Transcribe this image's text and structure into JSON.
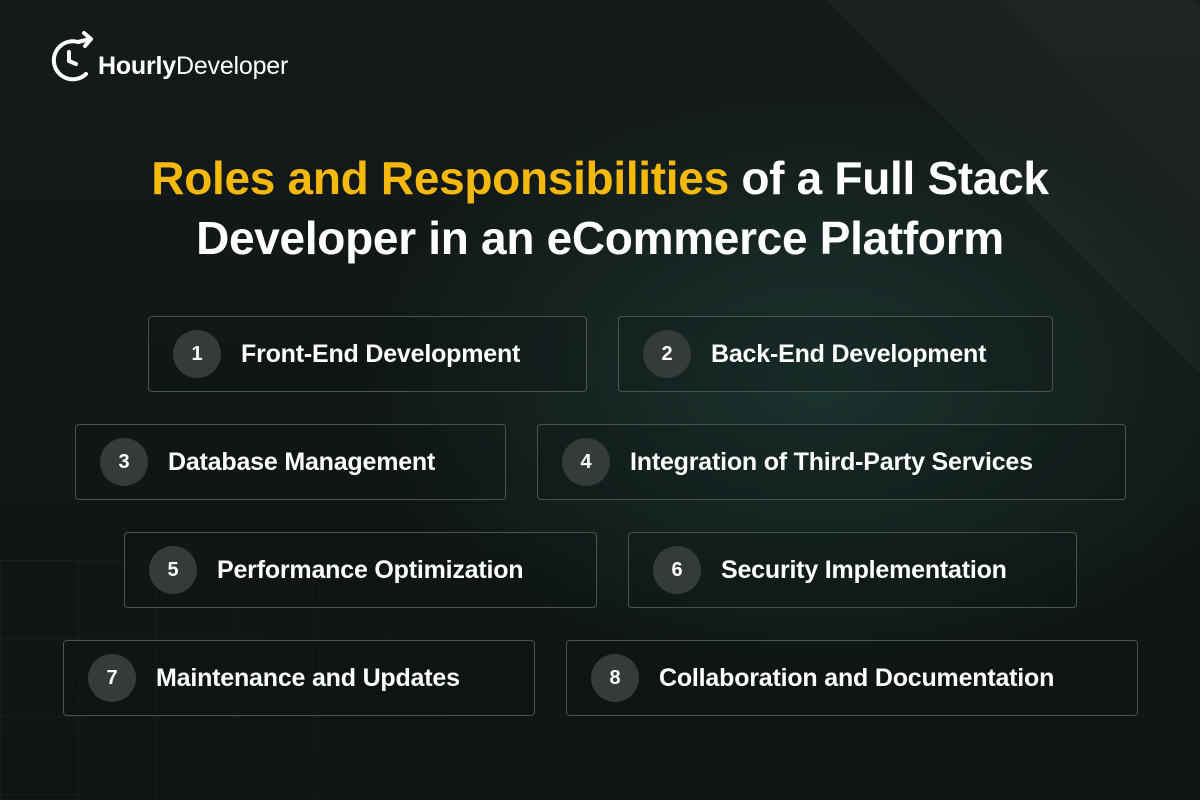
{
  "logo": {
    "brand_bold": "Hourly",
    "brand_regular": "Developer"
  },
  "heading": {
    "highlight": "Roles and Responsibilities",
    "rest_line1": " of a Full Stack",
    "line2": "Developer in an eCommerce Platform"
  },
  "colors": {
    "accent": "#f5b90b",
    "background": "#131919",
    "pill_border": "#4a5352",
    "number_circle": "#353b3b"
  },
  "items": [
    {
      "number": "1",
      "label": "Front-End Development"
    },
    {
      "number": "2",
      "label": "Back-End Development"
    },
    {
      "number": "3",
      "label": "Database Management"
    },
    {
      "number": "4",
      "label": "Integration of Third-Party Services"
    },
    {
      "number": "5",
      "label": "Performance Optimization"
    },
    {
      "number": "6",
      "label": "Security Implementation"
    },
    {
      "number": "7",
      "label": "Maintenance and Updates"
    },
    {
      "number": "8",
      "label": "Collaboration and Documentation"
    }
  ]
}
